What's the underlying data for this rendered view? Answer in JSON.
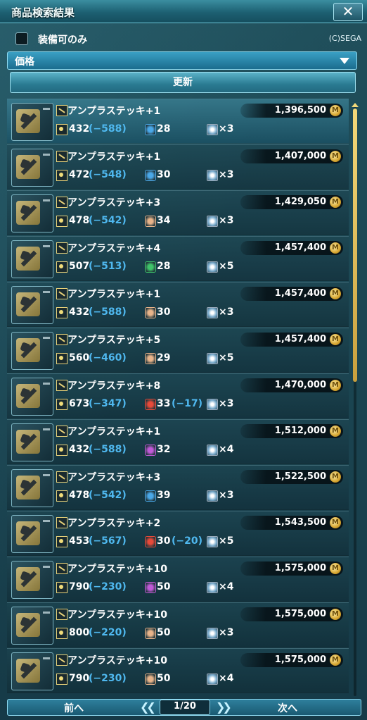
{
  "window": {
    "title": "商品検索結果",
    "close_label": "✕"
  },
  "filter": {
    "equip_only_label": "装備可のみ",
    "copyright": "(C)SEGA"
  },
  "sort": {
    "selected": "価格"
  },
  "update_label": "更新",
  "items": [
    {
      "name": "アンプラステッキ+1",
      "price": "1,396,500",
      "atk": "432",
      "atk_diff": "(−588)",
      "elem_icon": "ice-element-icon",
      "elem": "28",
      "elem_diff": "",
      "slots": "×3"
    },
    {
      "name": "アンプラステッキ+1",
      "price": "1,407,000",
      "atk": "472",
      "atk_diff": "(−548)",
      "elem_icon": "ice-element-icon",
      "elem": "30",
      "elem_diff": "",
      "slots": "×3"
    },
    {
      "name": "アンプラステッキ+3",
      "price": "1,429,050",
      "atk": "478",
      "atk_diff": "(−542)",
      "elem_icon": "light-element-icon",
      "elem": "34",
      "elem_diff": "",
      "slots": "×3"
    },
    {
      "name": "アンプラステッキ+4",
      "price": "1,457,400",
      "atk": "507",
      "atk_diff": "(−513)",
      "elem_icon": "wind-element-icon",
      "elem": "28",
      "elem_diff": "",
      "slots": "×5"
    },
    {
      "name": "アンプラステッキ+1",
      "price": "1,457,400",
      "atk": "432",
      "atk_diff": "(−588)",
      "elem_icon": "light-element-icon",
      "elem": "30",
      "elem_diff": "",
      "slots": "×3"
    },
    {
      "name": "アンプラステッキ+5",
      "price": "1,457,400",
      "atk": "560",
      "atk_diff": "(−460)",
      "elem_icon": "light-element-icon",
      "elem": "29",
      "elem_diff": "",
      "slots": "×5"
    },
    {
      "name": "アンプラステッキ+8",
      "price": "1,470,000",
      "atk": "673",
      "atk_diff": "(−347)",
      "elem_icon": "fire-element-icon",
      "elem": "33",
      "elem_diff": "(−17)",
      "slots": "×3"
    },
    {
      "name": "アンプラステッキ+1",
      "price": "1,512,000",
      "atk": "432",
      "atk_diff": "(−588)",
      "elem_icon": "dark-element-icon",
      "elem": "32",
      "elem_diff": "",
      "slots": "×4"
    },
    {
      "name": "アンプラステッキ+3",
      "price": "1,522,500",
      "atk": "478",
      "atk_diff": "(−542)",
      "elem_icon": "ice-element-icon",
      "elem": "39",
      "elem_diff": "",
      "slots": "×3"
    },
    {
      "name": "アンプラステッキ+2",
      "price": "1,543,500",
      "atk": "453",
      "atk_diff": "(−567)",
      "elem_icon": "fire-element-icon",
      "elem": "30",
      "elem_diff": "(−20)",
      "slots": "×5"
    },
    {
      "name": "アンプラステッキ+10",
      "price": "1,575,000",
      "atk": "790",
      "atk_diff": "(−230)",
      "elem_icon": "dark-element-icon",
      "elem": "50",
      "elem_diff": "",
      "slots": "×4"
    },
    {
      "name": "アンプラステッキ+10",
      "price": "1,575,000",
      "atk": "800",
      "atk_diff": "(−220)",
      "elem_icon": "light-element-icon",
      "elem": "50",
      "elem_diff": "",
      "slots": "×3"
    },
    {
      "name": "アンプラステッキ+10",
      "price": "1,575,000",
      "atk": "790",
      "atk_diff": "(−230)",
      "elem_icon": "light-element-icon",
      "elem": "50",
      "elem_diff": "",
      "slots": "×4"
    }
  ],
  "pager": {
    "prev_label": "前へ",
    "next_label": "次へ",
    "page": "1/20"
  },
  "colors": {
    "accent": "#4fb8ef",
    "price_icon": "#d6a530",
    "ice": "#4aa8e8",
    "light": "#e8b48a",
    "wind": "#3fc46a",
    "fire": "#e84a3a",
    "dark": "#c05ad8"
  }
}
